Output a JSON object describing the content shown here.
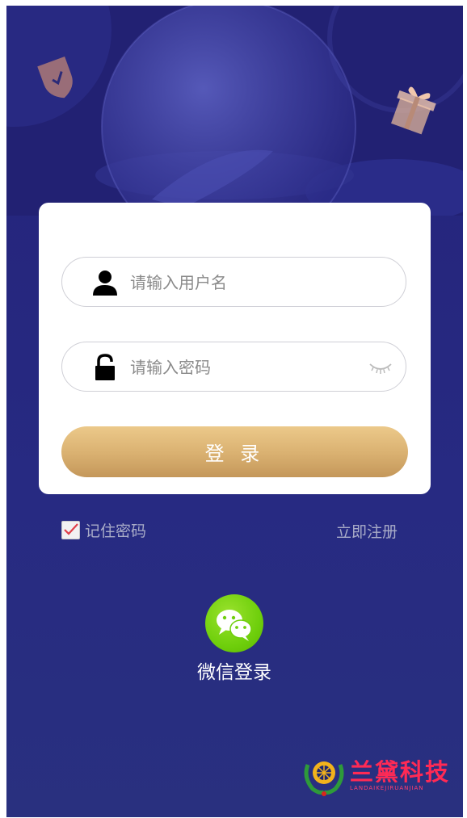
{
  "login_form": {
    "username_placeholder": "请输入用户名",
    "password_placeholder": "请输入密码",
    "login_button": "登 录"
  },
  "options": {
    "remember_label": "记住密码",
    "remember_checked": true,
    "register_link": "立即注册"
  },
  "social": {
    "wechat_label": "微信登录"
  },
  "brand": {
    "name": "兰黛科技",
    "subtitle": "LANDAIKEJIRUANJIAN"
  },
  "icons": {
    "username": "user-icon",
    "password": "lock-icon",
    "toggle": "eye-closed-icon",
    "wechat": "wechat-icon"
  },
  "colors": {
    "background": "#24237a",
    "button_gold": "#d9b070",
    "link": "#a9acc8",
    "wechat_green": "#6fcf0c",
    "brand_red": "#ff2a55"
  }
}
